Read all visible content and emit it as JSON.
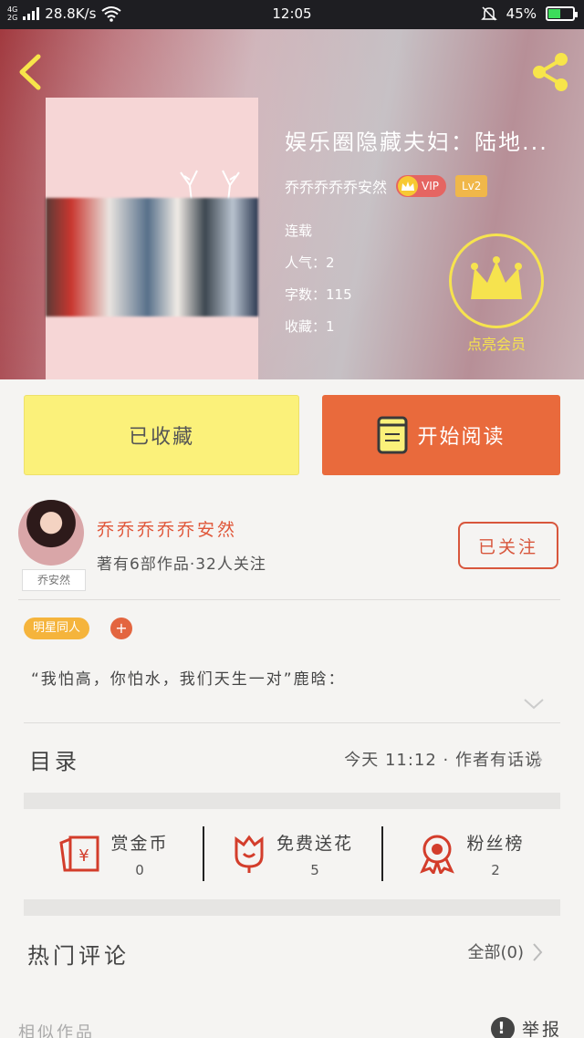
{
  "status_bar": {
    "network_top": "4G",
    "network_bottom": "2G",
    "speed": "28.8K/s",
    "time": "12:05",
    "battery": "45%",
    "battery_level": 0.45
  },
  "header": {
    "book_title": "娱乐圈隐藏夫妇：陆地...",
    "author": "乔乔乔乔乔安然",
    "vip_label": "VIP",
    "level": "Lv2",
    "status": "连载",
    "popularity": "人气：2",
    "word_count": "字数：115",
    "favorites": "收藏：1",
    "member_label": "点亮会员"
  },
  "actions": {
    "collected_label": "已收藏",
    "read_label": "开始阅读"
  },
  "author": {
    "name": "乔乔乔乔乔安然",
    "stats": "著有6部作品·32人关注",
    "avatar_tag": "乔安然",
    "follow_label": "已关注"
  },
  "tags": {
    "category": "明星同人",
    "add": "+"
  },
  "intro": "“我怕高，你怕水，我们天生一对”鹿晗：",
  "catalog": {
    "title": "目录",
    "latest": "今天 11:12 · 作者有话说"
  },
  "stats": [
    {
      "label": "赏金币",
      "value": "0",
      "icon": "red-envelope-icon"
    },
    {
      "label": "免费送花",
      "value": "5",
      "icon": "flower-icon"
    },
    {
      "label": "粉丝榜",
      "value": "2",
      "icon": "medal-icon"
    }
  ],
  "comments": {
    "title": "热门评论",
    "all_label": "全部(0)"
  },
  "footer": {
    "similar": "相似作品",
    "report": "举报"
  },
  "colors": {
    "accent_orange": "#e96a3c",
    "collected_yellow": "#fbf17a",
    "author_red": "#e0573a",
    "member_yellow": "#f6e34e"
  }
}
